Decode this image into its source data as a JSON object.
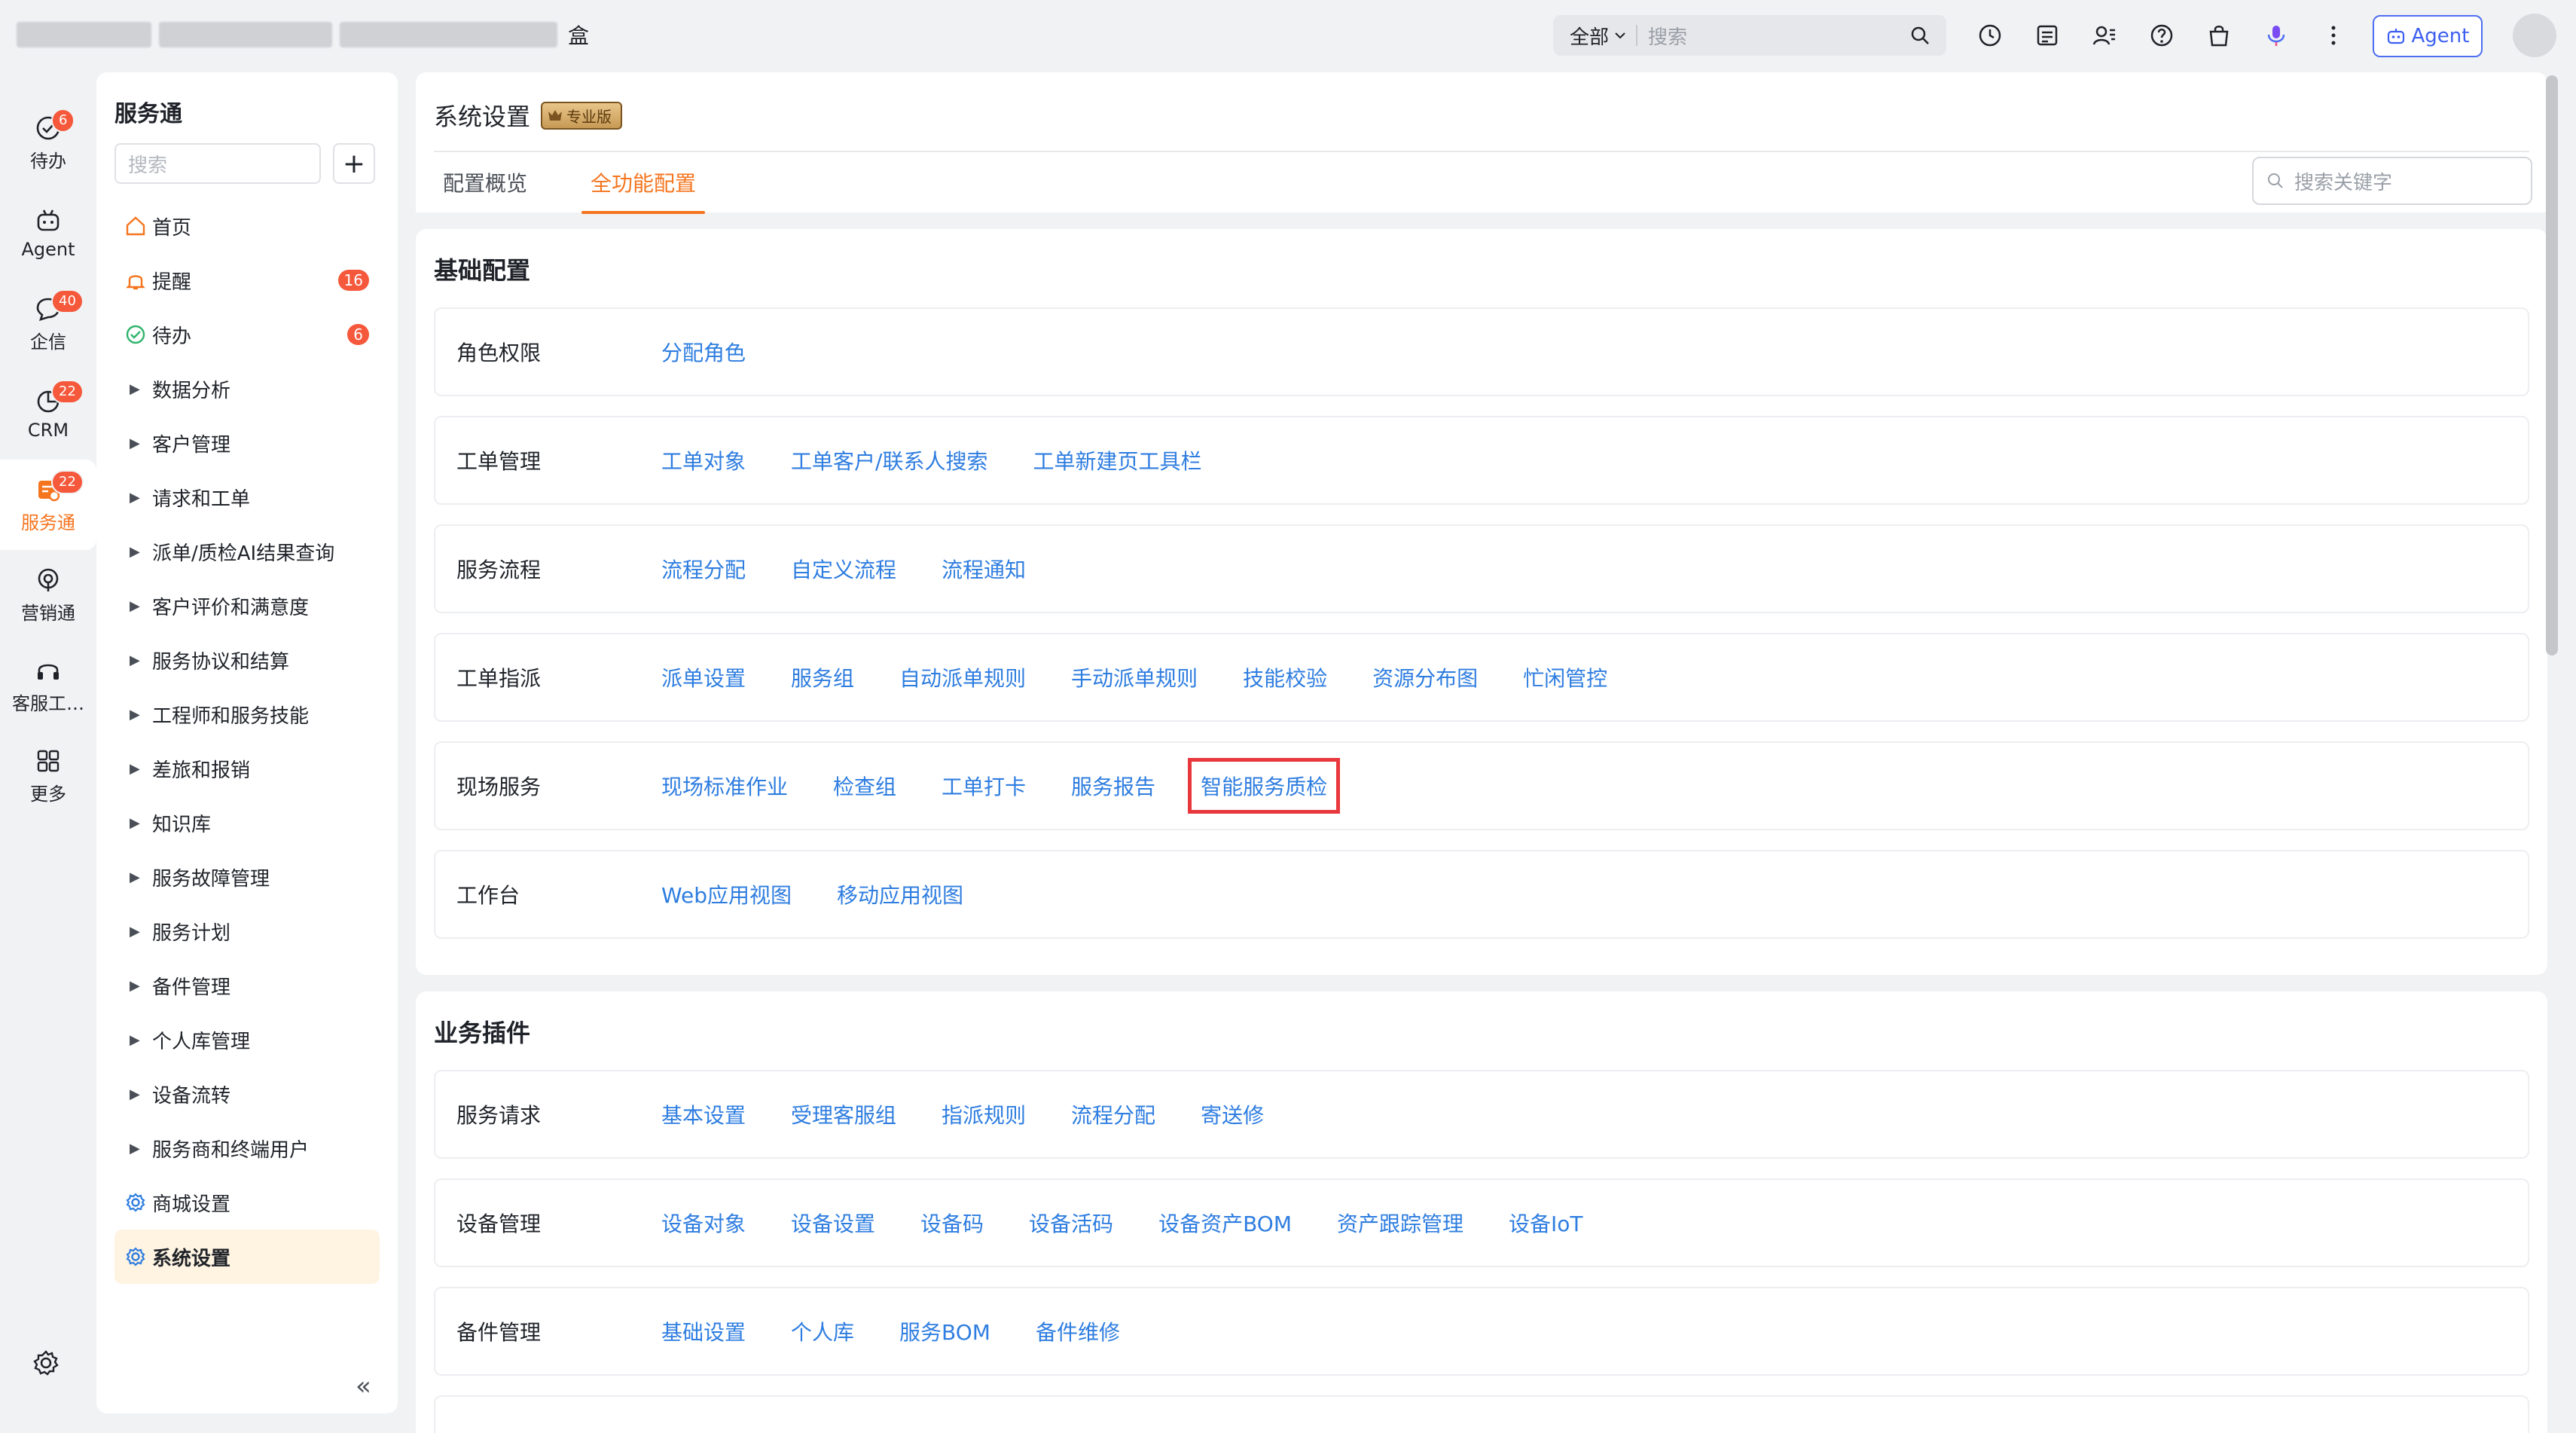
{
  "topbar": {
    "brand_tail": "盒",
    "scope": "全部",
    "search_placeholder": "搜索",
    "agent_label": "Agent"
  },
  "rail": {
    "items": [
      {
        "label": "待办",
        "badge": "6"
      },
      {
        "label": "Agent",
        "badge": ""
      },
      {
        "label": "企信",
        "badge": "40"
      },
      {
        "label": "CRM",
        "badge": "22"
      },
      {
        "label": "服务通",
        "badge": "22"
      },
      {
        "label": "营销通",
        "badge": ""
      },
      {
        "label": "客服工…",
        "badge": ""
      },
      {
        "label": "更多",
        "badge": ""
      }
    ]
  },
  "sidebar": {
    "title": "服务通",
    "search_placeholder": "搜索",
    "add_label": "+",
    "items": [
      {
        "label": "首页",
        "badge": ""
      },
      {
        "label": "提醒",
        "badge": "16"
      },
      {
        "label": "待办",
        "badge": "6"
      },
      {
        "label": "数据分析"
      },
      {
        "label": "客户管理"
      },
      {
        "label": "请求和工单"
      },
      {
        "label": "派单/质检AI结果查询"
      },
      {
        "label": "客户评价和满意度"
      },
      {
        "label": "服务协议和结算"
      },
      {
        "label": "工程师和服务技能"
      },
      {
        "label": "差旅和报销"
      },
      {
        "label": "知识库"
      },
      {
        "label": "服务故障管理"
      },
      {
        "label": "服务计划"
      },
      {
        "label": "备件管理"
      },
      {
        "label": "个人库管理"
      },
      {
        "label": "设备流转"
      },
      {
        "label": "服务商和终端用户"
      },
      {
        "label": "商城设置"
      },
      {
        "label": "系统设置"
      }
    ],
    "collapse_label": "«"
  },
  "main": {
    "title": "系统设置",
    "edition_badge": "专业版",
    "tabs": [
      "配置概览",
      "全功能配置"
    ],
    "keyword_placeholder": "搜索关键字",
    "basic": {
      "title": "基础配置",
      "rows": [
        {
          "label": "角色权限",
          "links": [
            "分配角色"
          ]
        },
        {
          "label": "工单管理",
          "links": [
            "工单对象",
            "工单客户/联系人搜索",
            "工单新建页工具栏"
          ]
        },
        {
          "label": "服务流程",
          "links": [
            "流程分配",
            "自定义流程",
            "流程通知"
          ]
        },
        {
          "label": "工单指派",
          "links": [
            "派单设置",
            "服务组",
            "自动派单规则",
            "手动派单规则",
            "技能校验",
            "资源分布图",
            "忙闲管控"
          ]
        },
        {
          "label": "现场服务",
          "links": [
            "现场标准作业",
            "检查组",
            "工单打卡",
            "服务报告",
            "智能服务质检"
          ]
        },
        {
          "label": "工作台",
          "links": [
            "Web应用视图",
            "移动应用视图"
          ]
        }
      ]
    },
    "plugins": {
      "title": "业务插件",
      "rows": [
        {
          "label": "服务请求",
          "links": [
            "基本设置",
            "受理客服组",
            "指派规则",
            "流程分配",
            "寄送修"
          ]
        },
        {
          "label": "设备管理",
          "links": [
            "设备对象",
            "设备设置",
            "设备码",
            "设备活码",
            "设备资产BOM",
            "资产跟踪管理",
            "设备IoT"
          ]
        },
        {
          "label": "备件管理",
          "links": [
            "基础设置",
            "个人库",
            "服务BOM",
            "备件维修"
          ]
        }
      ]
    }
  },
  "colors": {
    "accent": "#f5751f",
    "link": "#2e7de0",
    "highlight": "#e8383d",
    "badge": "#f5583b"
  }
}
